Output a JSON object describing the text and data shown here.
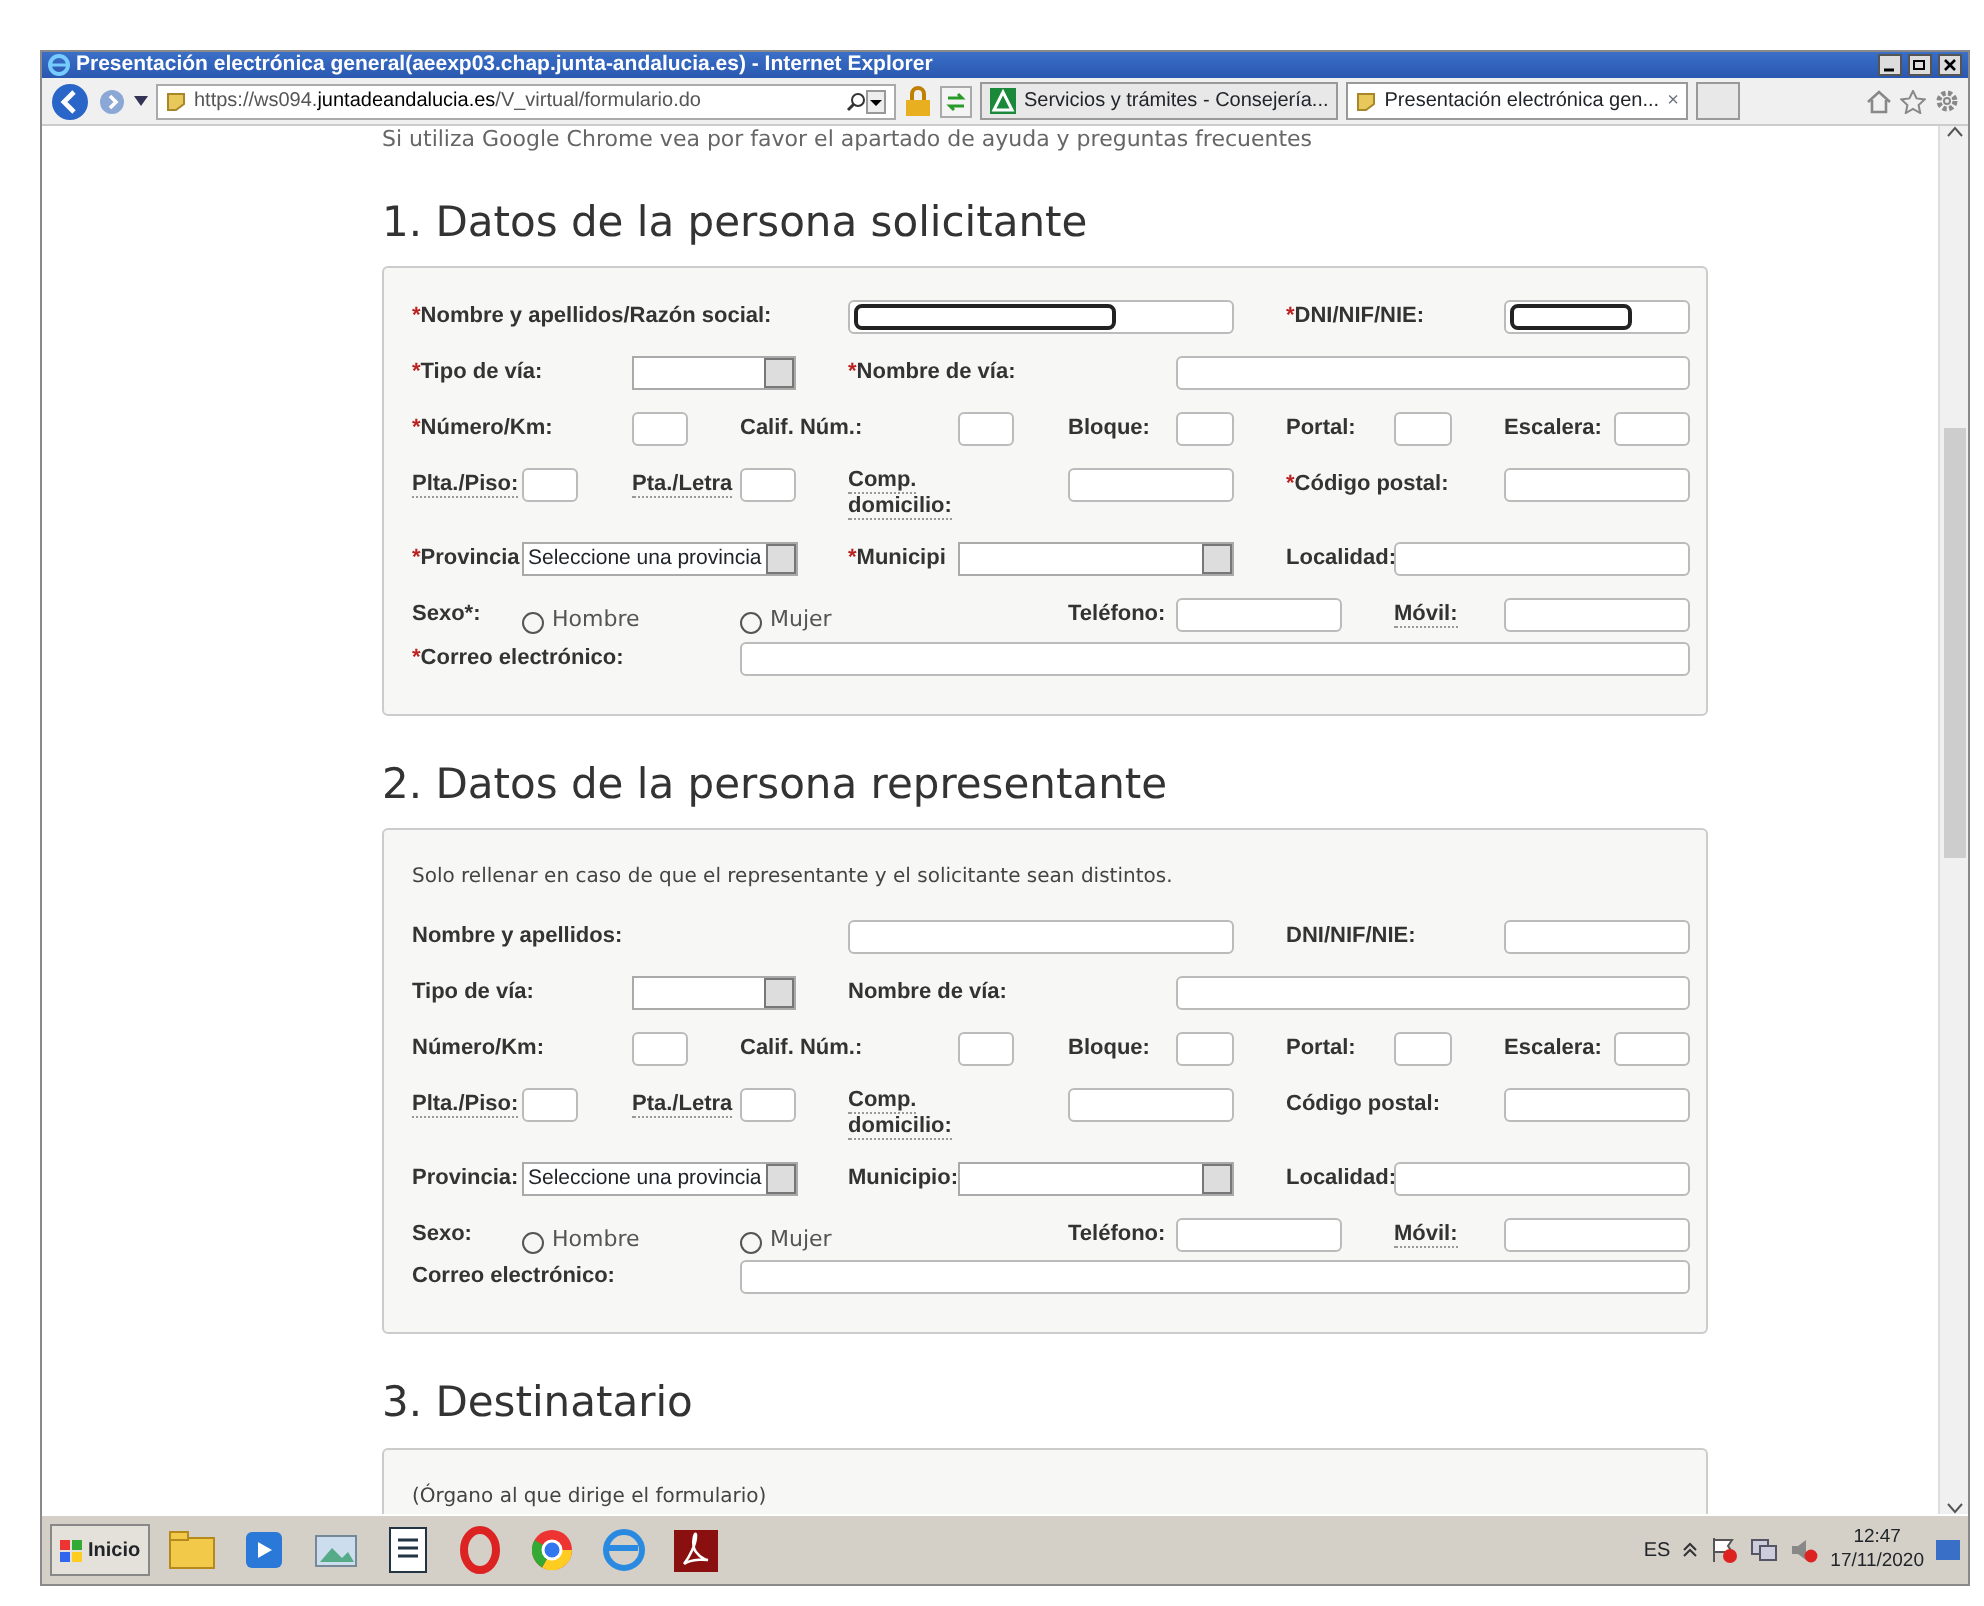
{
  "window": {
    "title": "Presentación electrónica general(aeexp03.chap.junta-andalucia.es) - Internet Explorer"
  },
  "address_bar": {
    "url": "https://ws094.**juntadeandalucia.es**/V_virtual/formulario.do"
  },
  "tabs": [
    {
      "label": "Servicios y trámites - Consejería...",
      "selected": false
    },
    {
      "label": "Presentación electrónica gen...",
      "selected": true,
      "close": "×"
    }
  ],
  "page": {
    "notice": "Si utiliza Google Chrome vea por favor el apartado de ayuda y preguntas frecuentes",
    "sections": [
      {
        "heading": "1. Datos de la persona solicitante",
        "rows": [
          {
            "fields": [
              {
                "mark": "*",
                "label": "Nombre y apellidos/Razón social:",
                "control": {
                  "kind": "input",
                  "redacted": true
                }
              },
              {
                "mark": "*",
                "label": "DNI/NIF/NIE:",
                "control": {
                  "kind": "input",
                  "redacted": true
                }
              }
            ]
          },
          {
            "fields": [
              {
                "mark": "*",
                "label": "Tipo de vía:",
                "control": {
                  "kind": "select"
                }
              },
              {
                "mark": "*",
                "label": "Nombre de vía:",
                "control": {
                  "kind": "input"
                }
              }
            ]
          },
          {
            "fields": [
              {
                "mark": "*",
                "label": "Número/Km:",
                "control": {
                  "kind": "input"
                }
              },
              {
                "label": "Calif. Núm.:",
                "control": {
                  "kind": "input"
                }
              },
              {
                "label": "Bloque:",
                "control": {
                  "kind": "input"
                }
              },
              {
                "label": "Portal:",
                "control": {
                  "kind": "input"
                }
              },
              {
                "label": "Escalera:",
                "control": {
                  "kind": "input"
                }
              }
            ]
          },
          {
            "fields": [
              {
                "label": "Plta./Piso:",
                "abbr": true,
                "control": {
                  "kind": "input"
                }
              },
              {
                "label": "Pta./Letra",
                "abbr": true,
                "control": {
                  "kind": "input"
                }
              },
              {
                "label": "Comp. domicilio:",
                "abbr": true,
                "control": {
                  "kind": "input"
                }
              },
              {
                "mark": "*",
                "label": "Código postal:",
                "control": {
                  "kind": "input"
                }
              }
            ]
          },
          {
            "fields": [
              {
                "mark": "*",
                "label": "Provincia",
                "control": {
                  "kind": "select",
                  "value": "Seleccione una provincia"
                }
              },
              {
                "mark": "*",
                "label": "Municipi",
                "control": {
                  "kind": "select"
                }
              },
              {
                "label": "Localidad:",
                "control": {
                  "kind": "input"
                }
              }
            ]
          },
          {
            "fields": [
              {
                "label": "Sexo*:",
                "control": {
                  "kind": "radios",
                  "options": [
                    {
                      "text": "Hombre",
                      "selected": false
                    },
                    {
                      "text": "Mujer",
                      "selected": false
                    }
                  ]
                }
              },
              {
                "label": "Teléfono:",
                "control": {
                  "kind": "input"
                }
              },
              {
                "label": "Móvil:",
                "abbr": true,
                "control": {
                  "kind": "input"
                }
              }
            ]
          },
          {
            "fields": [
              {
                "mark": "*",
                "label": "Correo electrónico:",
                "control": {
                  "kind": "input"
                }
              }
            ]
          }
        ]
      },
      {
        "heading": "2. Datos de la persona representante",
        "note": "Solo rellenar en caso de que el representante y el solicitante sean distintos.",
        "rows": [
          {
            "fields": [
              {
                "label": "Nombre y apellidos:",
                "control": {
                  "kind": "input"
                }
              },
              {
                "label": "DNI/NIF/NIE:",
                "control": {
                  "kind": "input"
                }
              }
            ]
          },
          {
            "fields": [
              {
                "label": "Tipo de vía:",
                "control": {
                  "kind": "select"
                }
              },
              {
                "label": "Nombre de vía:",
                "control": {
                  "kind": "input"
                }
              }
            ]
          },
          {
            "fields": [
              {
                "label": "Número/Km:",
                "control": {
                  "kind": "input"
                }
              },
              {
                "label": "Calif. Núm.:",
                "control": {
                  "kind": "input"
                }
              },
              {
                "label": "Bloque:",
                "control": {
                  "kind": "input"
                }
              },
              {
                "label": "Portal:",
                "control": {
                  "kind": "input"
                }
              },
              {
                "label": "Escalera:",
                "control": {
                  "kind": "input"
                }
              }
            ]
          },
          {
            "fields": [
              {
                "label": "Plta./Piso:",
                "abbr": true,
                "control": {
                  "kind": "input"
                }
              },
              {
                "label": "Pta./Letra",
                "abbr": true,
                "control": {
                  "kind": "input"
                }
              },
              {
                "label": "Comp. domicilio:",
                "abbr": true,
                "control": {
                  "kind": "input"
                }
              },
              {
                "label": "Código postal:",
                "control": {
                  "kind": "input"
                }
              }
            ]
          },
          {
            "fields": [
              {
                "label": "Provincia:",
                "control": {
                  "kind": "select",
                  "value": "Seleccione una provincia"
                }
              },
              {
                "label": "Municipio:",
                "control": {
                  "kind": "select"
                }
              },
              {
                "label": "Localidad:",
                "control": {
                  "kind": "input"
                }
              }
            ]
          },
          {
            "fields": [
              {
                "label": "Sexo:",
                "control": {
                  "kind": "radios",
                  "options": [
                    {
                      "text": "Hombre",
                      "selected": false
                    },
                    {
                      "text": "Mujer",
                      "selected": false
                    }
                  ]
                }
              },
              {
                "label": "Teléfono:",
                "control": {
                  "kind": "input"
                }
              },
              {
                "label": "Móvil:",
                "abbr": true,
                "control": {
                  "kind": "input"
                }
              }
            ]
          },
          {
            "fields": [
              {
                "label": "Correo electrónico:",
                "control": {
                  "kind": "input"
                }
              }
            ]
          }
        ]
      },
      {
        "heading": "3. Destinatario",
        "note": "(Órgano al que dirige el formulario)"
      }
    ]
  },
  "taskbar": {
    "start": "Inicio",
    "language": "ES",
    "time": "12:47",
    "date": "17/11/2020"
  }
}
